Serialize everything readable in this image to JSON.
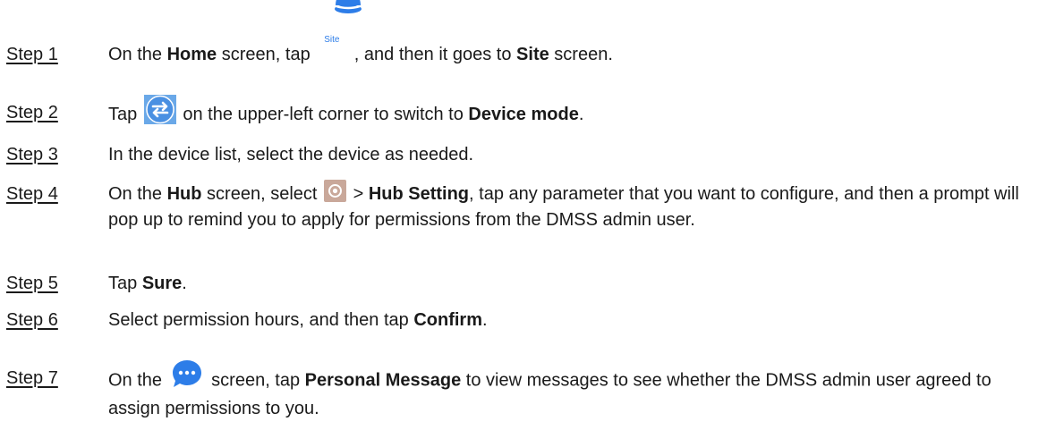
{
  "steps": [
    {
      "label": "Step 1",
      "parts": {
        "p1": "On the ",
        "b1": "Home",
        "p2": "  screen, tap ",
        "icon_text": "Site",
        "p3": " , and then it goes to ",
        "b2": "Site",
        "p4": " screen."
      }
    },
    {
      "label": "Step 2",
      "parts": {
        "p1": "Tap ",
        "p2": " on the upper-left corner to switch to ",
        "b1": "Device mode",
        "p3": "."
      }
    },
    {
      "label": "Step 3",
      "text": "In the device list, select the device as needed."
    },
    {
      "label": "Step 4",
      "parts": {
        "p1": "On the ",
        "b1": "Hub",
        "p2": "  screen, select ",
        "p3": "  > ",
        "b2": "Hub Setting",
        "p4": ", tap any parameter that you want to configure, and then a prompt will pop up to remind you to apply for permissions from the DMSS admin user."
      }
    },
    {
      "label": "Step 5",
      "parts": {
        "p1": "Tap ",
        "b1": "Sure",
        "p2": "."
      }
    },
    {
      "label": "Step 6",
      "parts": {
        "p1": "Select permission hours, and then tap ",
        "b1": "Confirm",
        "p2": "."
      }
    },
    {
      "label": "Step 7",
      "parts": {
        "p1": "On the ",
        "p2": " screen, tap ",
        "b1": "Personal Message",
        "p3": "  to view messages to see whether the DMSS admin user agreed to assign permissions to you."
      }
    }
  ],
  "icons": {
    "site": "site-icon",
    "switch": "switch-mode-icon",
    "settings": "settings-icon",
    "message": "message-bubble-icon"
  },
  "colors": {
    "accent_blue": "#2d7de8",
    "switch_blue": "#4a90e2",
    "gear_bg": "#c9a89a",
    "text": "#1a1a1a"
  }
}
